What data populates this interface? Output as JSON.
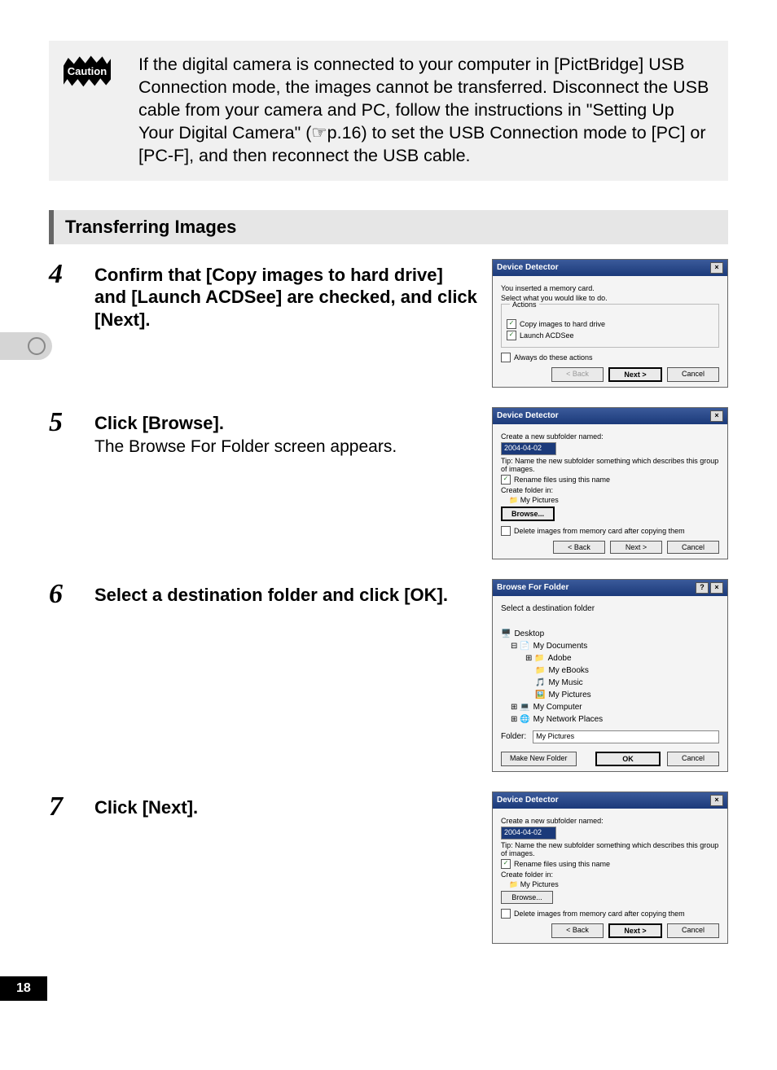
{
  "caution_badge": "Caution",
  "caution_text": "If the digital camera is connected to your computer in [PictBridge] USB Connection mode, the images cannot be transferred. Disconnect the USB cable from your camera and PC, follow the instructions in \"Setting Up Your Digital Camera\" (☞p.16) to set the USB Connection mode to [PC] or [PC-F], and then reconnect the USB cable.",
  "section_title": "Transferring Images",
  "steps": {
    "s4": {
      "num": "4",
      "head": "Confirm that [Copy images to hard drive] and [Launch ACDSee] are checked, and click [Next]."
    },
    "s5": {
      "num": "5",
      "head": "Click [Browse].",
      "sub": "The Browse For Folder screen appears."
    },
    "s6": {
      "num": "6",
      "head": "Select a destination folder and click [OK]."
    },
    "s7": {
      "num": "7",
      "head": "Click [Next]."
    }
  },
  "dlg1": {
    "title": "Device Detector",
    "line1": "You inserted a memory card.",
    "line2": "Select what you would like to do.",
    "group": "Actions",
    "opt1": "Copy images to hard drive",
    "opt2": "Launch ACDSee",
    "always": "Always do these actions",
    "back": "< Back",
    "next": "Next >",
    "cancel": "Cancel"
  },
  "dlg2": {
    "title": "Device Detector",
    "l1": "Create a new subfolder named:",
    "val": "2004-04-02",
    "tip": "Tip: Name the new subfolder something which describes this group of images.",
    "rename": "Rename files using this name",
    "l2": "Create folder in:",
    "folder": "My Pictures",
    "browse": "Browse...",
    "del": "Delete images from memory card after copying them",
    "back": "< Back",
    "next": "Next >",
    "cancel": "Cancel"
  },
  "dlg3": {
    "title": "Browse For Folder",
    "instr": "Select a destination folder",
    "tree": {
      "n0": "Desktop",
      "n1": "My Documents",
      "n2": "Adobe",
      "n3": "My eBooks",
      "n4": "My Music",
      "n5": "My Pictures",
      "n6": "My Computer",
      "n7": "My Network Places"
    },
    "folder_lbl": "Folder:",
    "folder_val": "My Pictures",
    "mknew": "Make New Folder",
    "ok": "OK",
    "cancel": "Cancel"
  },
  "dlg4": {
    "title": "Device Detector",
    "l1": "Create a new subfolder named:",
    "val": "2004-04-02",
    "tip": "Tip: Name the new subfolder something which describes this group of images.",
    "rename": "Rename files using this name",
    "l2": "Create folder in:",
    "folder": "My Pictures",
    "browse": "Browse...",
    "del": "Delete images from memory card after copying them",
    "back": "< Back",
    "next": "Next >",
    "cancel": "Cancel"
  },
  "page_number": "18"
}
